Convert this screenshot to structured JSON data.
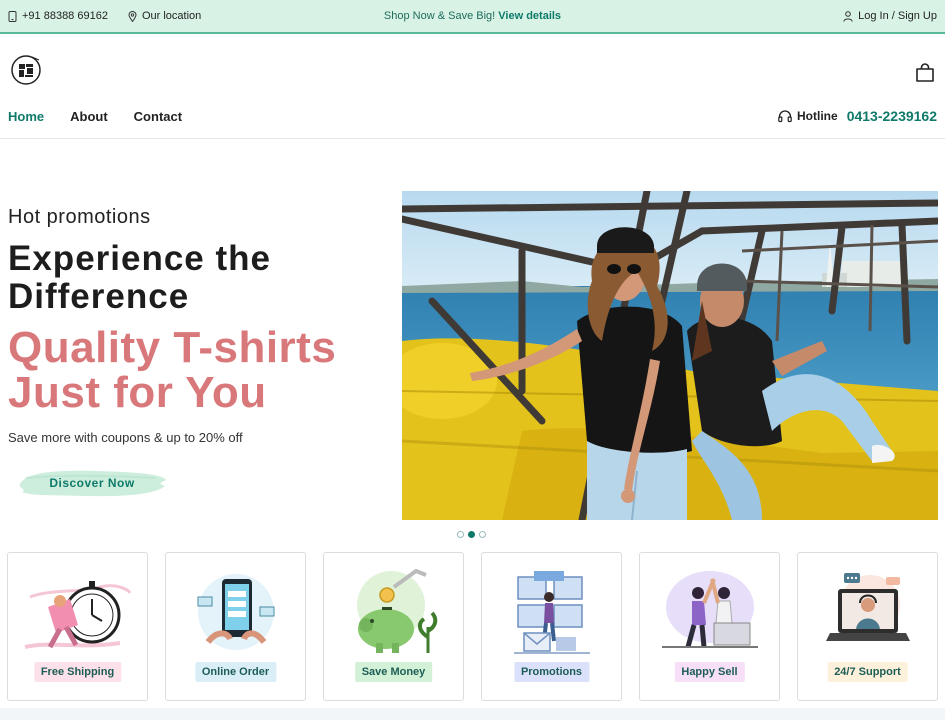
{
  "topbar": {
    "phone": "+91 88388 69162",
    "location": "Our location",
    "promo_text": "Shop Now & Save Big!",
    "promo_link": "View details",
    "auth": "Log In / Sign Up"
  },
  "nav": {
    "items": [
      "Home",
      "About",
      "Contact"
    ],
    "hotline_label": "Hotline",
    "hotline_number": "0413-2239162"
  },
  "hero": {
    "kicker": "Hot promotions",
    "title": "Experience the Difference",
    "accent": "Quality T-shirts Just for You",
    "subtitle": "Save more with coupons & up to 20% off",
    "cta": "Discover Now",
    "slide_count": 3,
    "active_slide": 2
  },
  "features": [
    {
      "label": "Free Shipping",
      "badge_color": "#fde1ea"
    },
    {
      "label": "Online Order",
      "badge_color": "#d9eef7"
    },
    {
      "label": "Save Money",
      "badge_color": "#d3f1d7"
    },
    {
      "label": "Promotions",
      "badge_color": "#dbe0fb"
    },
    {
      "label": "Happy Sell",
      "badge_color": "#f7dff7"
    },
    {
      "label": "24/7 Support",
      "badge_color": "#fdf1dc"
    }
  ],
  "colors": {
    "brand": "#0f7a6a",
    "accent": "#d9787a",
    "topbar_bg": "#d8f3e6"
  }
}
